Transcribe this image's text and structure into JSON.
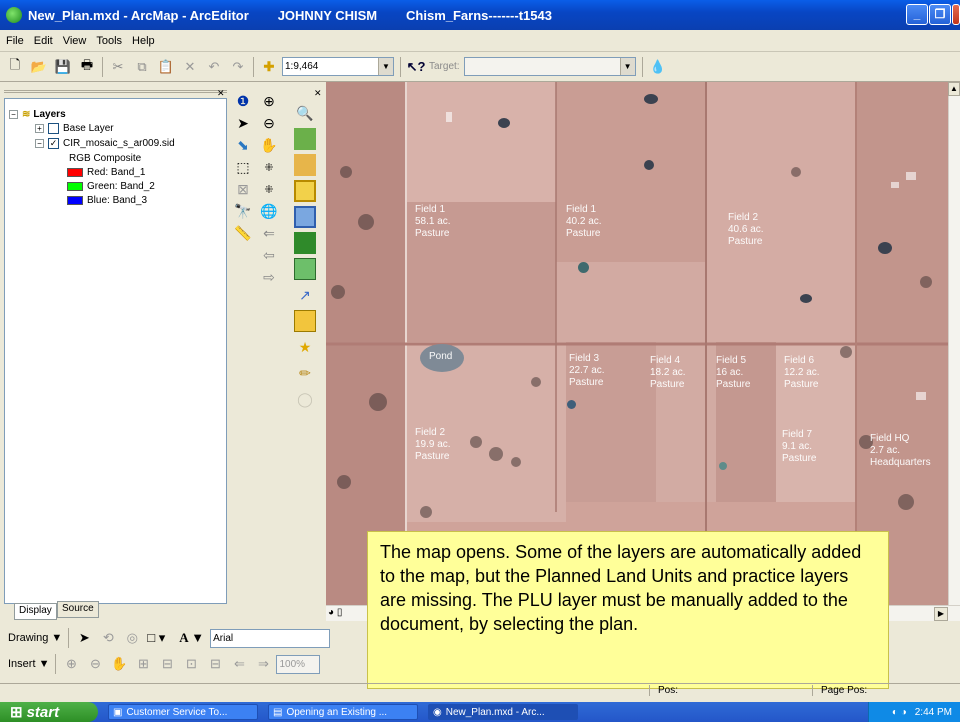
{
  "window": {
    "title": "New_Plan.mxd - ArcMap - ArcEditor        JOHNNY CHISM        Chism_Farns-------t1543",
    "controls": [
      "_",
      "❐",
      "✕"
    ]
  },
  "menu": [
    "File",
    "Edit",
    "View",
    "Tools",
    "Help"
  ],
  "toolbar": {
    "scale": "1:9,464",
    "target_label": "Target:",
    "target_value": ""
  },
  "toc": {
    "root": "Layers",
    "base_layer": "Base Layer",
    "raster_layer": "CIR_mosaic_s_ar009.sid",
    "rgb_label": "RGB Composite",
    "bands": [
      {
        "label": "Red:   Band_1",
        "color": "#ff0000"
      },
      {
        "label": "Green: Band_2",
        "color": "#00ff00"
      },
      {
        "label": "Blue:   Band_3",
        "color": "#0000ff"
      }
    ],
    "tabs": {
      "display": "Display",
      "source": "Source"
    }
  },
  "map": {
    "fields": [
      {
        "name": "Field 1",
        "acres": "58.1 ac.",
        "use": "Pasture"
      },
      {
        "name": "Field 1",
        "acres": "40.2 ac.",
        "use": "Pasture"
      },
      {
        "name": "Field 2",
        "acres": "40.6 ac.",
        "use": "Pasture"
      },
      {
        "name": "Field 3",
        "acres": "22.7 ac.",
        "use": "Pasture"
      },
      {
        "name": "Field 4",
        "acres": "18.2 ac.",
        "use": "Pasture"
      },
      {
        "name": "Field 5",
        "acres": "16 ac.",
        "use": "Pasture"
      },
      {
        "name": "Field 6",
        "acres": "12.2 ac.",
        "use": "Pasture"
      },
      {
        "name": "Field 7",
        "acres": "9.1 ac.",
        "use": "Pasture"
      },
      {
        "name": "Field 2",
        "acres": "19.9 ac.",
        "use": "Pasture"
      },
      {
        "name": "Field  HQ",
        "acres": "2.7 ac.",
        "use": "Headquarters"
      }
    ],
    "pond_label": "Pond"
  },
  "callout": "The map opens. Some of the layers are automatically added to the map, but the Planned Land Units and practice layers are missing. The PLU layer must be manually added to the document, by selecting the plan.",
  "drawbar": {
    "drawing": "Drawing ▼",
    "font": "Arial",
    "text_tool": "A ▼"
  },
  "insertbar": {
    "insert": "Insert ▼",
    "zoom": "100%"
  },
  "status": {
    "pos": "Pos:",
    "page_pos": "Page Pos:"
  },
  "taskbar": {
    "start": "start",
    "tasks": [
      "Customer Service To...",
      "Opening an Existing ...",
      "New_Plan.mxd - Arc..."
    ],
    "clock": "2:44 PM"
  }
}
